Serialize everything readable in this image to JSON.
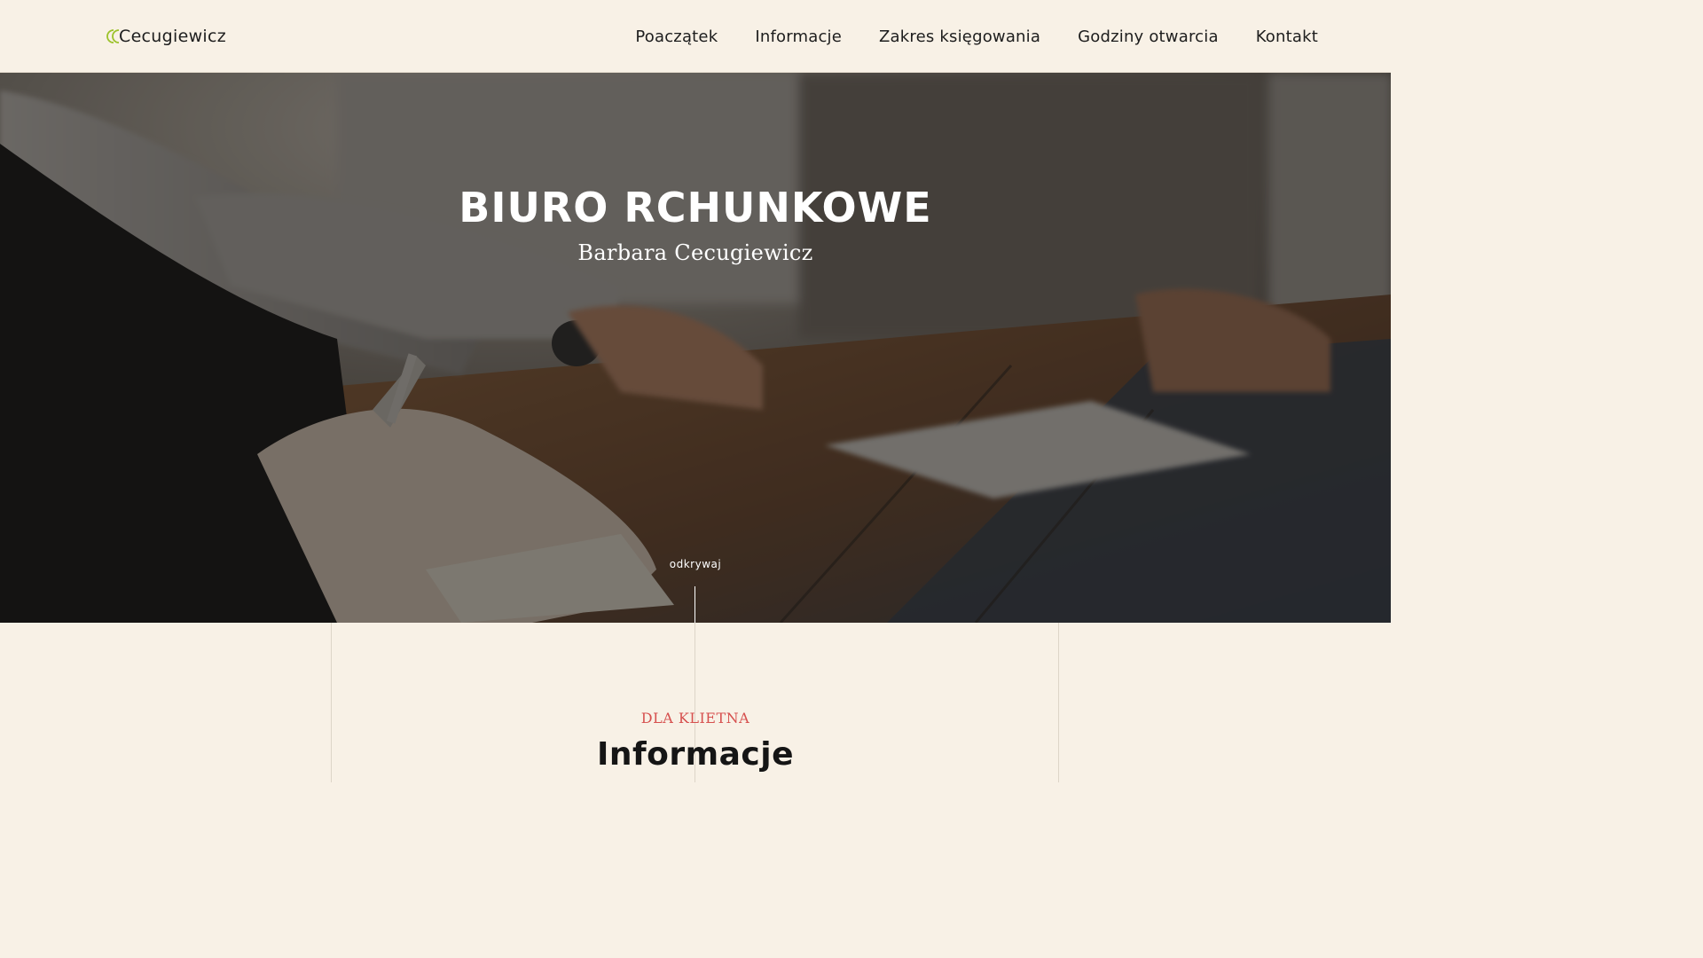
{
  "brand": {
    "logo_text": "Cecugiewicz",
    "logo_icon": "cc-logo-icon",
    "accent_color": "#9cc22a"
  },
  "nav": {
    "items": [
      {
        "label": "Poaczątek"
      },
      {
        "label": "Informacje"
      },
      {
        "label": "Zakres księgowania"
      },
      {
        "label": "Godziny otwarcia"
      },
      {
        "label": "Kontakt"
      }
    ]
  },
  "hero": {
    "title": "BIURO RCHUNKOWE",
    "subtitle": "Barbara Cecugiewicz",
    "discover_label": "odkrywaj",
    "overlay_color": "#141210"
  },
  "info_section": {
    "eyebrow": "DLA KLIETNA",
    "eyebrow_color": "#d6504e",
    "title": "Informacje"
  },
  "colors": {
    "background": "#f8f1e6",
    "text": "#1d1d1d"
  }
}
